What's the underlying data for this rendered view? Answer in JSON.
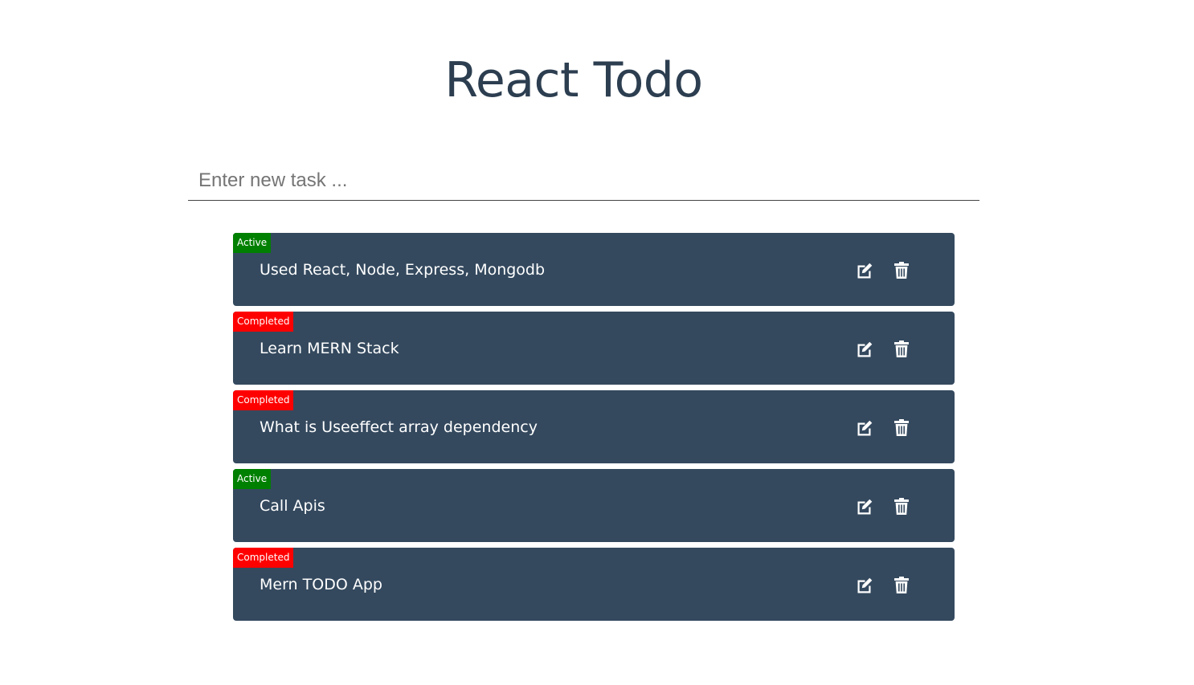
{
  "header": {
    "title": "React Todo"
  },
  "new_task": {
    "placeholder": "Enter new task ...",
    "value": ""
  },
  "tasks": [
    {
      "status": "Active",
      "text": "Used React, Node, Express, Mongodb",
      "status_color": "#008000"
    },
    {
      "status": "Completed",
      "text": "Learn MERN Stack",
      "status_color": "#ff0000"
    },
    {
      "status": "Completed",
      "text": "What is Useeffect array dependency",
      "status_color": "#ff0000"
    },
    {
      "status": "Active",
      "text": "Call Apis",
      "status_color": "#008000"
    },
    {
      "status": "Completed",
      "text": "Mern TODO App",
      "status_color": "#ff0000"
    }
  ],
  "icons": {
    "edit": "edit-icon",
    "delete": "trash-icon"
  },
  "colors": {
    "card_bg": "#34495e",
    "title": "#2c3e50",
    "active": "#008000",
    "completed": "#ff0000"
  }
}
